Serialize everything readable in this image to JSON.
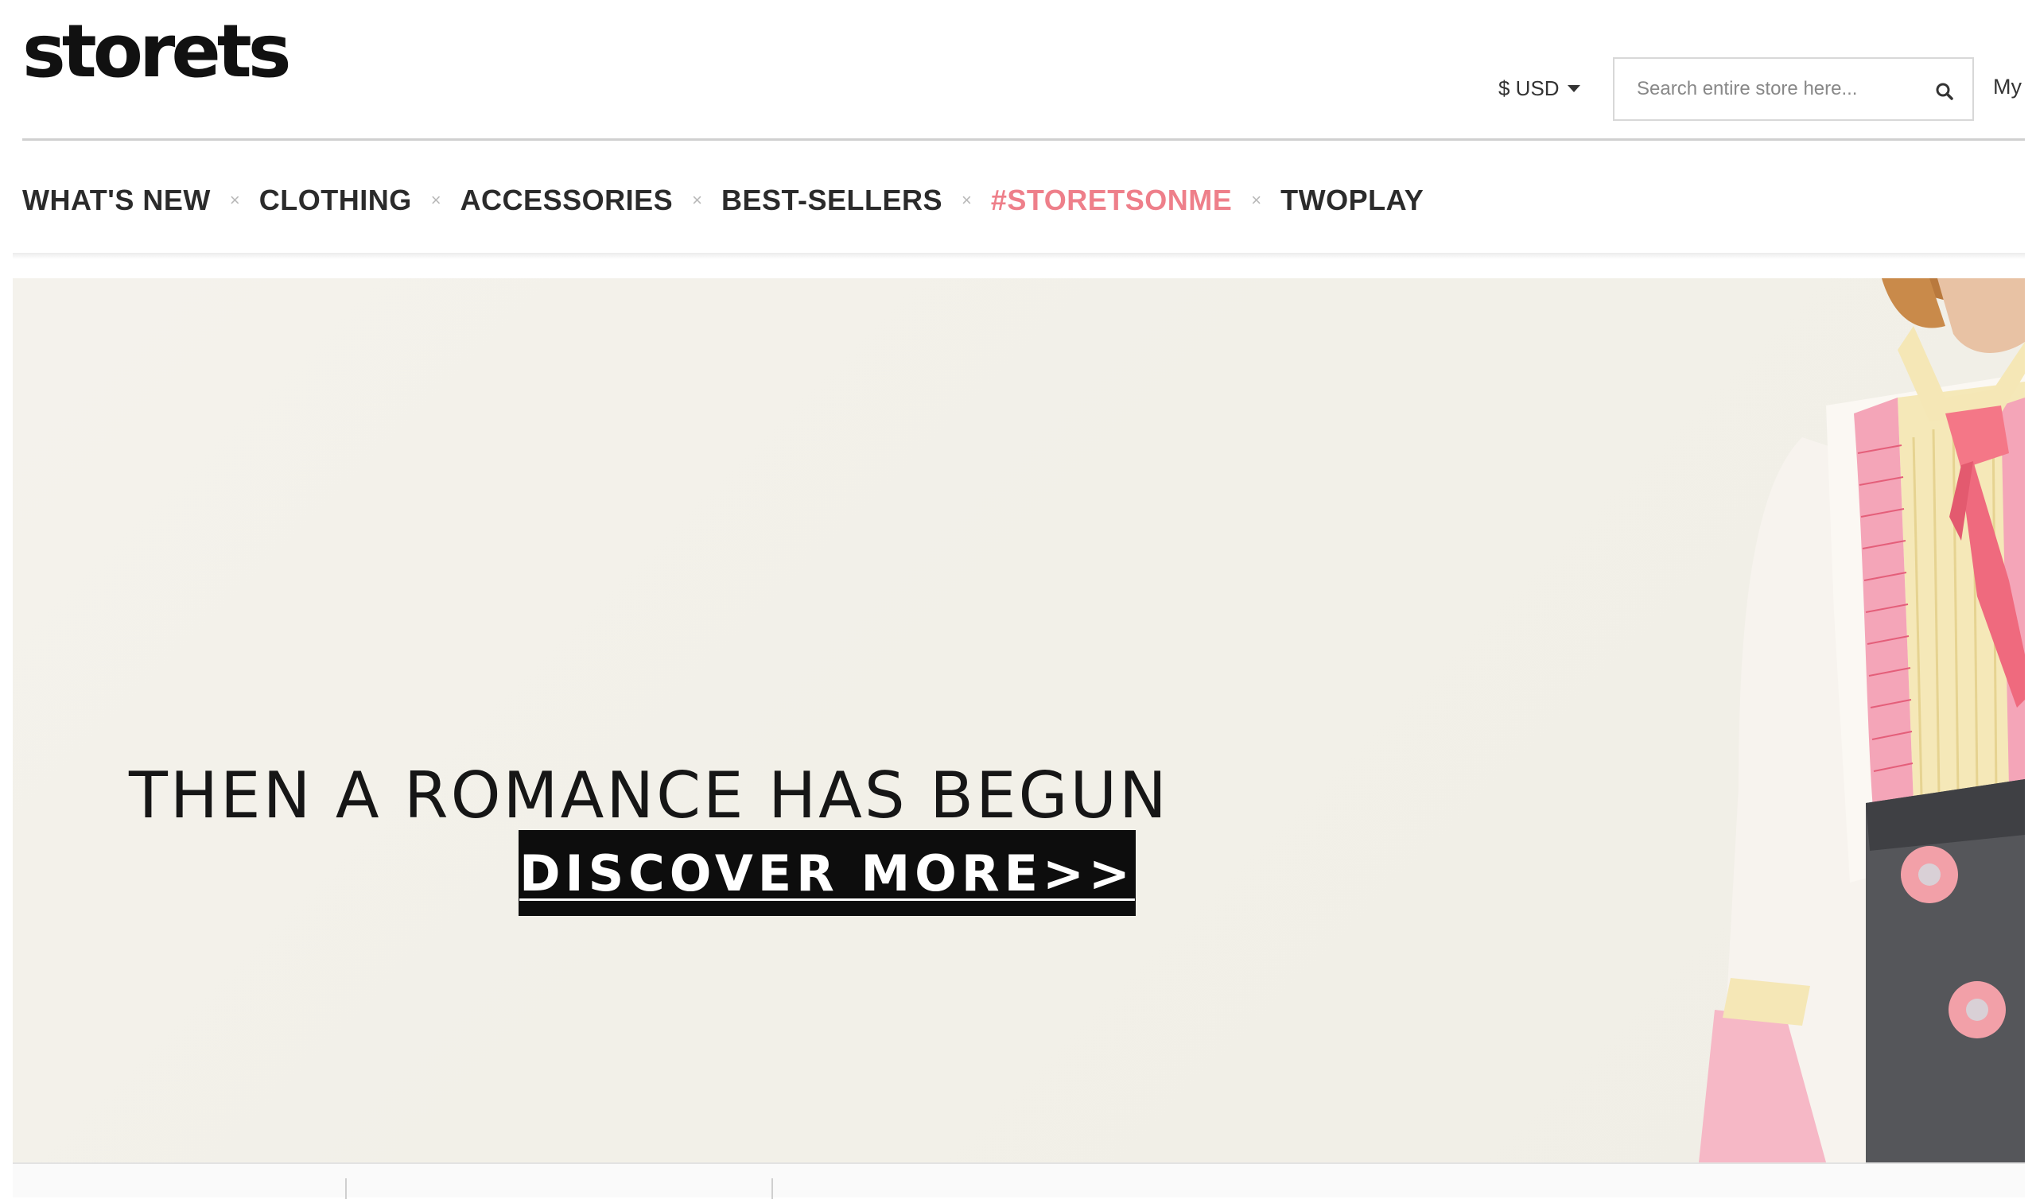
{
  "header": {
    "logo_text": "storets",
    "currency_label": "$ USD",
    "search": {
      "placeholder": "Search entire store here..."
    },
    "account_link": "My"
  },
  "nav": {
    "items": [
      {
        "label": "WHAT'S NEW"
      },
      {
        "label": "CLOTHING"
      },
      {
        "label": "ACCESSORIES"
      },
      {
        "label": "BEST-SELLERS"
      },
      {
        "label": "#STORETSONME",
        "accent": "#ee7f8a"
      },
      {
        "label": "TWOPLAY"
      }
    ],
    "separator": "×"
  },
  "hero": {
    "headline": "THEN A ROMANCE HAS BEGUN",
    "cta_label": "DISCOVER MORE>>"
  },
  "icons": {
    "search": "search-icon",
    "currency_dropdown": "chevron-down-icon"
  },
  "colors": {
    "accent_pink": "#ee7f8a",
    "cta_bg": "#0d0d0d",
    "hero_bg": "#f2f0e8"
  }
}
